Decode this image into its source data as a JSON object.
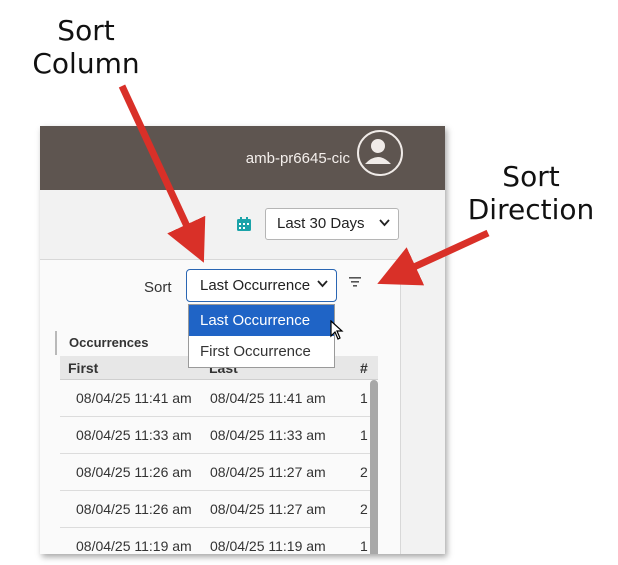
{
  "callouts": {
    "sort_column": "Sort Column",
    "sort_direction": "Sort Direction"
  },
  "header": {
    "account_name": "amb-pr6645-cic",
    "avatar_icon": "user-avatar-icon"
  },
  "date_filter": {
    "icon": "calendar-icon",
    "selected": "Last 30 Days"
  },
  "sort": {
    "label": "Sort",
    "selected": "Last Occurrence",
    "direction_icon": "sort-direction-icon",
    "options": [
      "Last Occurrence",
      "First Occurrence"
    ],
    "highlighted_option": "Last Occurrence"
  },
  "table": {
    "group_header": "Occurrences",
    "columns": [
      "First",
      "Last",
      "#"
    ],
    "rows": [
      [
        "08/04/25 11:41 am",
        "08/04/25 11:41 am",
        "1"
      ],
      [
        "08/04/25 11:33 am",
        "08/04/25 11:33 am",
        "1"
      ],
      [
        "08/04/25 11:26 am",
        "08/04/25 11:27 am",
        "2"
      ],
      [
        "08/04/25 11:26 am",
        "08/04/25 11:27 am",
        "2"
      ],
      [
        "08/04/25 11:19 am",
        "08/04/25 11:19 am",
        "1"
      ]
    ]
  },
  "colors": {
    "topbar": "#5e5550",
    "accent": "#1f64c6",
    "arrow": "#d93028"
  }
}
